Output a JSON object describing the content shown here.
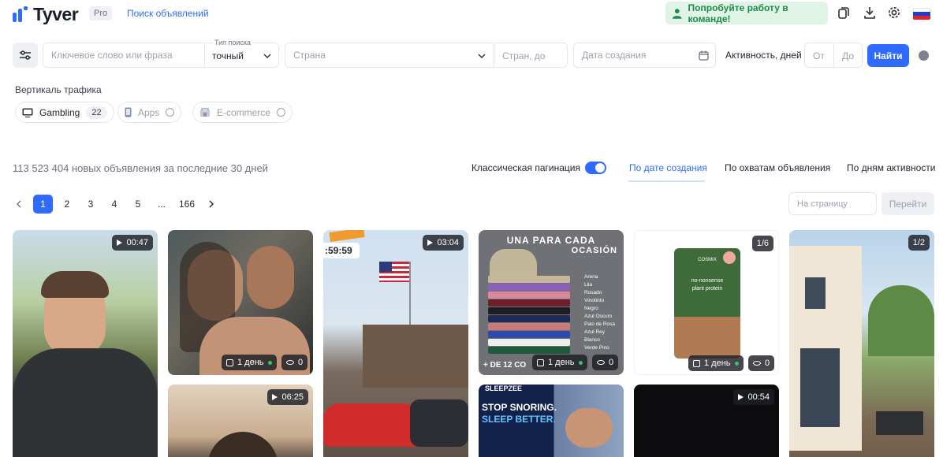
{
  "header": {
    "logo_text": "Tyver",
    "pro_badge": "Pro",
    "nav_link": "Поиск объявлений",
    "team_button": "Попробуйте работу в команде!",
    "icons": [
      "copy-icon",
      "download-icon",
      "settings-icon",
      "flag-ru-icon"
    ]
  },
  "filters": {
    "keyword_placeholder": "Ключевое слово или фраза",
    "search_type_label": "Тип поиска",
    "search_type_value": "точный",
    "country_placeholder": "Страна",
    "country_to_placeholder": "Стран, до",
    "date_placeholder": "Дата создания",
    "activity_label": "Активность, дней",
    "from_placeholder": "От",
    "to_placeholder": "До",
    "find_button": "Найти"
  },
  "vertical": {
    "title": "Вертикаль трафика",
    "chips": [
      {
        "label": "Gambling",
        "count": "22"
      },
      {
        "label": "Apps"
      },
      {
        "label": "E-commerce"
      }
    ]
  },
  "results": {
    "stats": "113 523 404 новых объявления за последние 30 дней",
    "pagination_label": "Классическая пагинация",
    "sort_tabs": [
      "По дате создания",
      "По охватам объявления",
      "По дням активности"
    ]
  },
  "pagination": {
    "pages": [
      "1",
      "2",
      "3",
      "4",
      "5",
      "...",
      "166"
    ],
    "page_placeholder": "На страницу",
    "go_button": "Перейти"
  },
  "cards": [
    {
      "duration": "00:47"
    },
    {
      "age": "1 день",
      "views": "0"
    },
    {
      "duration": "03:04",
      "timer": ":59:59"
    },
    {
      "title_line1": "UNA PARA CADA",
      "title_line2": "OCASIÓN",
      "colors": [
        "Arena",
        "Lila",
        "Rosado",
        "Vinotinto",
        "Negro",
        "Azul Oscuro",
        "Palo de Rosa",
        "Azul Rey",
        "Blanco",
        "Verde Pino"
      ],
      "footer": "+ DE 12 CO",
      "age": "1 день",
      "views": "0"
    },
    {
      "counter": "1/6",
      "brand": "COSMIX",
      "product_line1": "no-nonsense",
      "product_line2": "plant protein",
      "age": "1 день",
      "views": "0"
    },
    {
      "counter": "1/2"
    },
    {
      "duration": "06:25"
    },
    {
      "brand": "SLEEPZEE",
      "headline_line1": "STOP SNORING.",
      "headline_line2": "SLEEP BETTER."
    },
    {
      "duration": "00:54"
    }
  ]
}
